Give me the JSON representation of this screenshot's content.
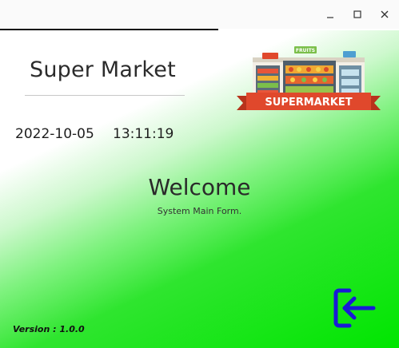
{
  "window": {
    "minimize_icon": "minimize-icon",
    "maximize_icon": "maximize-icon",
    "close_icon": "close-icon"
  },
  "header": {
    "title": "Super Market",
    "logo_text": "SUPERMARKET",
    "logo_sign_fruits": "FRUITS"
  },
  "clock": {
    "date": "2022-10-05",
    "time": "13:11:19"
  },
  "content": {
    "welcome": "Welcome",
    "subtitle": "System Main Form."
  },
  "footer": {
    "version": "Version : 1.0.0"
  },
  "actions": {
    "exit_icon": "logout-arrow-icon"
  },
  "colors": {
    "accent_green": "#00e600",
    "exit_blue": "#1a1ad6",
    "logo_red": "#e0482c"
  }
}
